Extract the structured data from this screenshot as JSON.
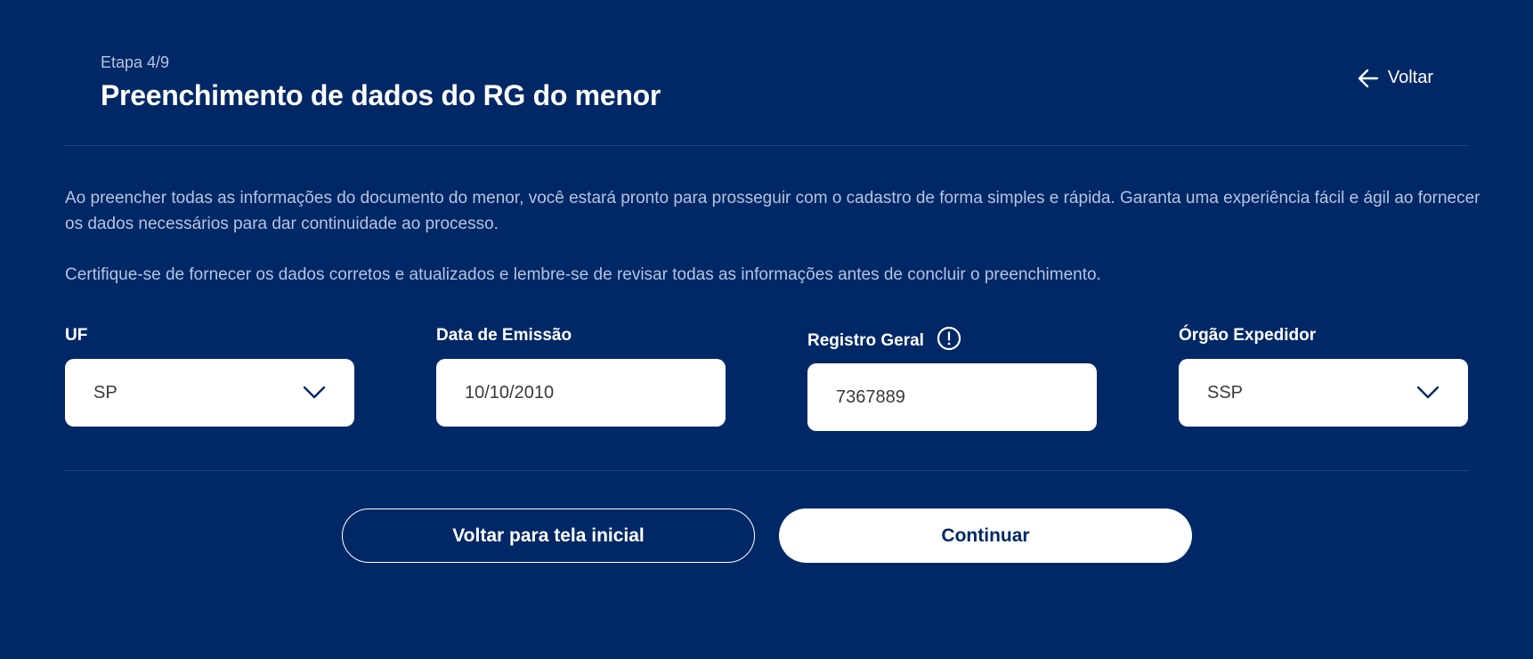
{
  "header": {
    "step": "Etapa 4/9",
    "title": "Preenchimento de dados do RG do menor",
    "back_label": "Voltar"
  },
  "description": {
    "paragraph1": "Ao preencher todas as informações do documento do menor, você estará pronto para prosseguir com o cadastro de forma simples e rápida. Garanta uma experiência fácil e ágil ao fornecer os dados necessários para dar continuidade ao processo.",
    "paragraph2": "Certifique-se de fornecer os dados corretos e atualizados e lembre-se de revisar todas as informações antes de concluir o preenchimento."
  },
  "fields": {
    "uf": {
      "label": "UF",
      "value": "SP"
    },
    "data_emissao": {
      "label": "Data de Emissão",
      "value": "10/10/2010"
    },
    "registro_geral": {
      "label": "Registro Geral",
      "value": "7367889"
    },
    "orgao_expedidor": {
      "label": "Órgão Expedidor",
      "value": "SSP"
    }
  },
  "actions": {
    "back_home_label": "Voltar para tela inicial",
    "continue_label": "Continuar"
  },
  "icons": {
    "back": "arrow-left-icon",
    "dropdown": "chevron-down-icon",
    "info": "exclamation-circle-icon"
  },
  "colors": {
    "background": "#012866",
    "text_primary": "#ffffff",
    "text_muted": "#b4c4e0",
    "input_background": "#ffffff",
    "chevron": "#012866"
  }
}
